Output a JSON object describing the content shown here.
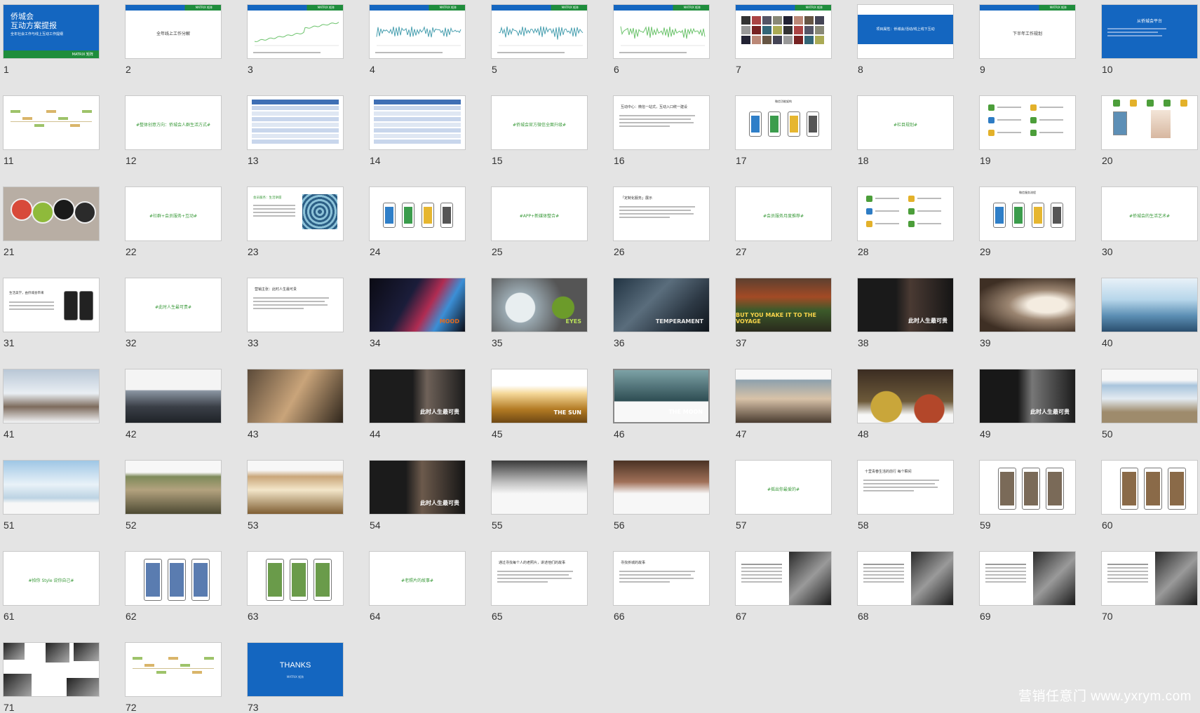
{
  "slides": [
    {
      "n": "1",
      "kind": "title",
      "title": "侨城会\n互动方案提报",
      "subtitle": "全年社会工作与线上互动工作提纲",
      "footer": "MATRIX 矩阵"
    },
    {
      "n": "2",
      "kind": "blank-title",
      "text": "全年线上工作分解"
    },
    {
      "n": "3",
      "kind": "chart",
      "color": "#6cc36c"
    },
    {
      "n": "4",
      "kind": "chart",
      "color": "#4aa0b0"
    },
    {
      "n": "5",
      "kind": "chart",
      "color": "#4aa0b0"
    },
    {
      "n": "6",
      "kind": "chart",
      "color": "#6cc36c"
    },
    {
      "n": "7",
      "kind": "mosaic"
    },
    {
      "n": "8",
      "kind": "bluebar",
      "text": "项目属性：侨城会/活动/线上线下互动"
    },
    {
      "n": "9",
      "kind": "blank-title",
      "text": "下半年工作规划"
    },
    {
      "n": "10",
      "kind": "bluetext",
      "text": "从侨城会平台"
    },
    {
      "n": "11",
      "kind": "mindmap"
    },
    {
      "n": "12",
      "kind": "green",
      "text": "#整体创意方向：侨城会人群生活方式#"
    },
    {
      "n": "13",
      "kind": "table"
    },
    {
      "n": "14",
      "kind": "table"
    },
    {
      "n": "15",
      "kind": "green",
      "text": "#侨城会官方微信全面升级#"
    },
    {
      "n": "16",
      "kind": "textblock",
      "text": "互动中心：微信一站式，互动入口统一建设"
    },
    {
      "n": "17",
      "kind": "phones4",
      "text": "微信功能架构"
    },
    {
      "n": "18",
      "kind": "green",
      "text": "#栏目规划#"
    },
    {
      "n": "19",
      "kind": "iconlist"
    },
    {
      "n": "20",
      "kind": "icons-top"
    },
    {
      "n": "21",
      "kind": "discs"
    },
    {
      "n": "22",
      "kind": "green",
      "text": "#社群+会员服务+互动#"
    },
    {
      "n": "23",
      "kind": "spiral",
      "text": "会员服务：生活讲座"
    },
    {
      "n": "24",
      "kind": "phones4"
    },
    {
      "n": "25",
      "kind": "green",
      "text": "#APP+新媒体整合#"
    },
    {
      "n": "26",
      "kind": "textblock",
      "text": "「定制化服务」展示"
    },
    {
      "n": "27",
      "kind": "green",
      "text": "#会员服务月度推荐#"
    },
    {
      "n": "28",
      "kind": "iconlist"
    },
    {
      "n": "29",
      "kind": "phones4",
      "text": "微信服务流程"
    },
    {
      "n": "30",
      "kind": "green",
      "text": "#侨城会的生活艺术#"
    },
    {
      "n": "31",
      "kind": "textphone",
      "text": "生活美学，由侨城会带来"
    },
    {
      "n": "32",
      "kind": "green",
      "text": "#此时人生最可贵#"
    },
    {
      "n": "33",
      "kind": "textblock",
      "text": "营销主张：此时人生最可贵"
    },
    {
      "n": "34",
      "kind": "photo",
      "bg": "linear-gradient(120deg,#0b0b14 0%,#1b1d3a 40%,#b02c52 60%,#3b8fd6 75%,#0b0b14 100%)",
      "cap": "MOOD",
      "capcolor": "#e36a1d"
    },
    {
      "n": "35",
      "kind": "photo",
      "bg": "radial-gradient(circle at 75% 55%,#6c9b2a 0 14%,transparent 15%),radial-gradient(circle at 30% 55%,#e8eef0 0 20%,#9aa9b1 21%,#555 60%)",
      "cap": "EYES",
      "capcolor": "#b9e05a"
    },
    {
      "n": "36",
      "kind": "photo",
      "bg": "linear-gradient(135deg,#223443,#5a6d7c 40%,#2d3945 70%,#0f151b)",
      "cap": "TEMPERAMENT",
      "capcolor": "#e6e6e6"
    },
    {
      "n": "37",
      "kind": "photo",
      "bg": "linear-gradient(180deg,#5d4030,#a34a25 35%,#3c5a2a 60%,#2a2a1d)",
      "cap": "BUT YOU MAKE IT TO THE VOYAGE",
      "capcolor": "#f6d34a"
    },
    {
      "n": "38",
      "kind": "photo",
      "bg": "linear-gradient(90deg,#1a1a1a 0 40%,#4a3a33 55%,#151515 100%)",
      "cap": "此时人生最可贵",
      "capcolor": "#fff"
    },
    {
      "n": "39",
      "kind": "photo",
      "bg": "radial-gradient(ellipse at 70% 50%,#f4ece0 0 20%,#9b8571 40%,#3e2f24 80%)",
      "cap": "",
      "capcolor": "#fff"
    },
    {
      "n": "40",
      "kind": "photo",
      "bg": "linear-gradient(180deg,#e8f1f8,#b7d6ea 40%,#5c8fb4 70%,#2a4e6e)",
      "cap": "",
      "capcolor": "#fff"
    },
    {
      "n": "41",
      "kind": "photo",
      "bg": "linear-gradient(180deg,#b9c7d6,#e9eef3 45%,#7d6b5d 70%,#f4f6f8)",
      "cap": "",
      "capcolor": "#fff"
    },
    {
      "n": "42",
      "kind": "photo",
      "bg": "linear-gradient(180deg,#f4f4f4 0 38%,#8b96a3 40%,#3a3f47 70%,#1f2328)",
      "cap": "",
      "capcolor": "#fff"
    },
    {
      "n": "43",
      "kind": "photo",
      "bg": "linear-gradient(120deg,#5b4a39,#c9a47a 50%,#2f261c)",
      "cap": "",
      "capcolor": "#fff"
    },
    {
      "n": "44",
      "kind": "photo",
      "bg": "linear-gradient(90deg,#1c1c1c 0 45%,#6f6259 60%,#1c1c1c)",
      "cap": "此时人生最可贵",
      "capcolor": "#fff"
    },
    {
      "n": "45",
      "kind": "photo",
      "bg": "linear-gradient(180deg,#fff 0 30%,#f5d898 45%,#b27a23 75%,#6e4814)",
      "cap": "THE SUN",
      "capcolor": "#fff"
    },
    {
      "n": "46",
      "kind": "photo",
      "bg": "linear-gradient(180deg,#7da2a6,#2d4c52 60%,#f8f8f8 60%)",
      "cap": "THE MOON",
      "capcolor": "#fff"
    },
    {
      "n": "47",
      "kind": "photo",
      "bg": "linear-gradient(180deg,#f7f7f7 0 18%,#8ea1ad 20%,#d8c2a8 55%,#4a3c30)",
      "cap": "",
      "capcolor": "#fff"
    },
    {
      "n": "48",
      "kind": "photo",
      "bg": "radial-gradient(circle at 30% 70%,#c9a63a 0 20%,transparent 21%),radial-gradient(circle at 75% 75%,#b3472a 0 18%,transparent 19%),linear-gradient(180deg,#3b2c22,#6d5a3a 60%,#f7f7f7 85%)",
      "cap": "",
      "capcolor": "#fff"
    },
    {
      "n": "49",
      "kind": "photo",
      "bg": "linear-gradient(90deg,#181818 0 40%,#777 55%,#1c1c1c)",
      "cap": "此时人生最可贵",
      "capcolor": "#fff"
    },
    {
      "n": "50",
      "kind": "photo",
      "bg": "linear-gradient(180deg,#f7f7f7 0 20%,#a9c4dc 30%,#e3ebf1 55%,#9e8b6c 80%)",
      "cap": "",
      "capcolor": "#fff"
    },
    {
      "n": "51",
      "kind": "photo",
      "bg": "linear-gradient(180deg,#9fc6e5,#e9f2f8 45%,#bcd3e3 70%,#f7f7f7 80%)",
      "cap": "",
      "capcolor": "#fff"
    },
    {
      "n": "52",
      "kind": "photo",
      "bg": "linear-gradient(180deg,#f7f7f7 0 22%,#7e8a5a 30%,#b3a27e 55%,#4d4a33)",
      "cap": "",
      "capcolor": "#fff"
    },
    {
      "n": "53",
      "kind": "photo",
      "bg": "linear-gradient(180deg,#f7f7f7 0 18%,#caa77a 30%,#f3e6c9 55%,#7f5e33)",
      "cap": "",
      "capcolor": "#fff"
    },
    {
      "n": "54",
      "kind": "photo",
      "bg": "linear-gradient(90deg,#1b1b1b 0 38%,#6c5a4c 55%,#151515)",
      "cap": "此时人生最可贵",
      "capcolor": "#fff"
    },
    {
      "n": "55",
      "kind": "photo",
      "bg": "linear-gradient(180deg,#3a3a3a,#bdbdbd 40%,#f7f7f7 62%)",
      "cap": "",
      "capcolor": "#fff"
    },
    {
      "n": "56",
      "kind": "photo",
      "bg": "linear-gradient(180deg,#4a3224,#a07058 40%,#f7f7f7 62%)",
      "cap": "",
      "capcolor": "#fff"
    },
    {
      "n": "57",
      "kind": "green",
      "text": "#摇出你最爱的#"
    },
    {
      "n": "58",
      "kind": "textblock",
      "text": "十里青春生活的前行 每个瞬间"
    },
    {
      "n": "59",
      "kind": "phones3",
      "accent": "#7a6a58"
    },
    {
      "n": "60",
      "kind": "phones3",
      "accent": "#8a6a48"
    },
    {
      "n": "61",
      "kind": "green",
      "text": "#拍你 Style 说你自己#"
    },
    {
      "n": "62",
      "kind": "phones3",
      "accent": "#5a7cb0"
    },
    {
      "n": "63",
      "kind": "phones3",
      "accent": "#6a9b4a"
    },
    {
      "n": "64",
      "kind": "green",
      "text": "#老照片的故事#"
    },
    {
      "n": "65",
      "kind": "textblock",
      "text": "通过寻找每个人的老照片，讲述他们的故事"
    },
    {
      "n": "66",
      "kind": "textblock",
      "text": "寻找侨城的故事"
    },
    {
      "n": "67",
      "kind": "bwphoto"
    },
    {
      "n": "68",
      "kind": "bwphoto"
    },
    {
      "n": "69",
      "kind": "bwphoto"
    },
    {
      "n": "70",
      "kind": "bwphoto"
    },
    {
      "n": "71",
      "kind": "bwcollage"
    },
    {
      "n": "72",
      "kind": "mindmap"
    },
    {
      "n": "73",
      "kind": "thanks",
      "text": "THANKS",
      "footer": "MATRIX 矩阵"
    }
  ],
  "watermark": "营销任意门 www.yxrym.com",
  "topbar_label": "MATRIX 矩阵"
}
